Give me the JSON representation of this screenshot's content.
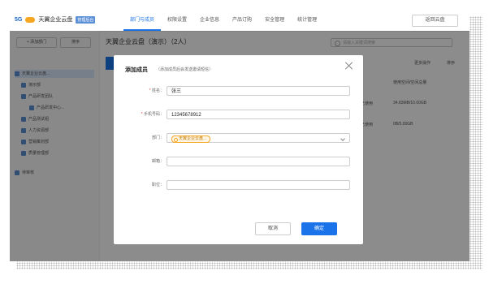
{
  "header": {
    "logo_5g": "5G",
    "app_name": "天翼企业云盘",
    "badge": "管理后台",
    "nav": [
      "部门与成员",
      "权限设置",
      "企业信息",
      "产品订购",
      "安全管理",
      "统计管理"
    ],
    "return_label": "返回云盘"
  },
  "sidebar": {
    "add_dept": "+ 添加部门",
    "sort": "排序",
    "items": [
      "天翼企业云盘...",
      "演示部",
      "产品研发团队",
      "产品研发中心...",
      "产品测试组",
      "人力资源部",
      "营销策划部",
      "质量管理部",
      "待审核"
    ]
  },
  "main": {
    "title": "天翼企业云盘（演示）（2人）",
    "search_placeholder": "请输入关键词搜索",
    "col_more": "更多操作",
    "col_sort": "排序",
    "col_usage": "使用空间/空间总量",
    "row1_usage": "34.83MB/10.00GB",
    "row2_usage": "0B/5.00GB",
    "row1_state": "已使用",
    "row2_state": "已使用"
  },
  "modal": {
    "title": "添加成员",
    "subtitle": "（添加成员后会发送邀请短信）",
    "fields": {
      "name_label": "姓名：",
      "name_value": "张三",
      "phone_label": "手机号码：",
      "phone_value": "12345678912",
      "dept_label": "部门：",
      "dept_value": "天翼企业云盘...",
      "email_label": "邮箱：",
      "position_label": "职位："
    },
    "cancel": "取消",
    "ok": "确定"
  }
}
